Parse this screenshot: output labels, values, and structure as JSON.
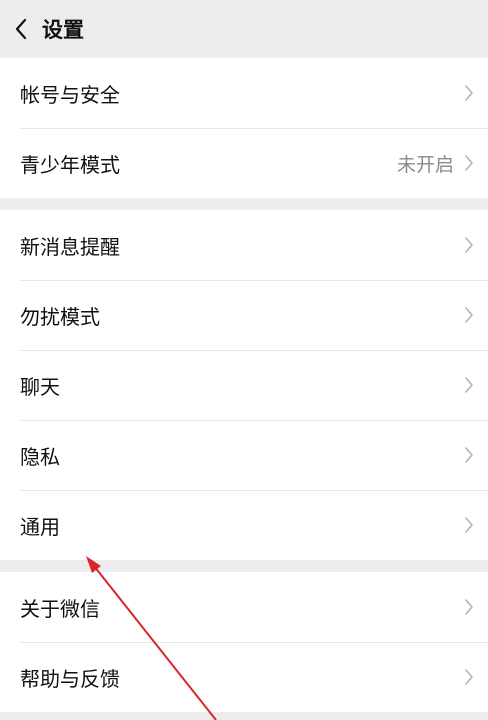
{
  "header": {
    "title": "设置"
  },
  "groups": [
    {
      "items": [
        {
          "label": "帐号与安全"
        },
        {
          "label": "青少年模式",
          "value": "未开启"
        }
      ]
    },
    {
      "items": [
        {
          "label": "新消息提醒"
        },
        {
          "label": "勿扰模式"
        },
        {
          "label": "聊天"
        },
        {
          "label": "隐私"
        },
        {
          "label": "通用"
        }
      ]
    },
    {
      "items": [
        {
          "label": "关于微信"
        },
        {
          "label": "帮助与反馈"
        }
      ]
    }
  ],
  "colors": {
    "background": "#ededed",
    "row": "#ffffff",
    "text": "#111111",
    "secondary_text": "#8a8a8a",
    "chevron": "#b2b2b2",
    "annotation_arrow": "#d9262c"
  },
  "icons": {
    "back": "chevron-left-icon",
    "row_chevron": "chevron-right-icon",
    "annotation": "red-arrow-annotation"
  }
}
